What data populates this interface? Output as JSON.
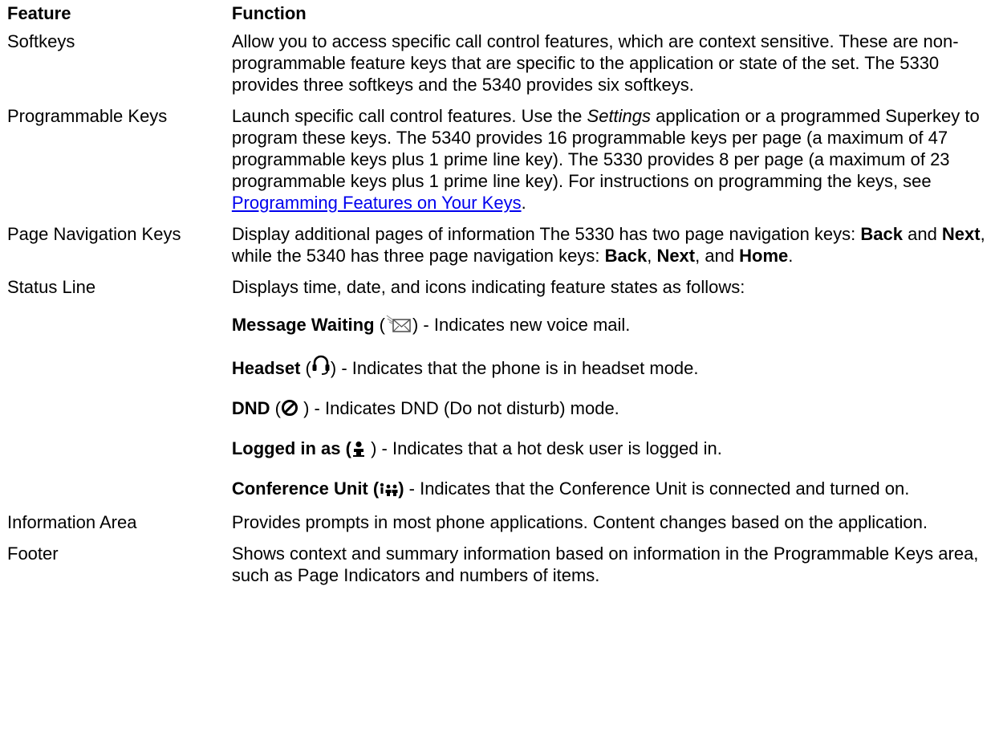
{
  "header": {
    "feature": "Feature",
    "function": "Function"
  },
  "rows": {
    "softkeys": {
      "feature": "Softkeys",
      "text": "Allow you to access specific call control features, which are context sensitive. These are non-programmable feature keys that are specific to the application or state of the set. The 5330 provides three softkeys and the 5340 provides six softkeys."
    },
    "programmable": {
      "feature": "Programmable Keys",
      "pre": "Launch specific call control features. Use the ",
      "italic": "Settings",
      "mid": " application or a programmed Superkey to program these keys. The 5340 provides 16 programmable keys per page (a maximum of 47 programmable keys plus 1 prime line key). The 5330 provides 8 per page (a maximum of 23 programmable keys plus 1 prime line key). For instructions on programming the keys, see ",
      "link": "Programming Features on Your Keys",
      "post": "."
    },
    "page_nav": {
      "feature": "Page Navigation Keys",
      "t1": "Display additional pages of information The 5330 has two page navigation keys: ",
      "b1": "Back",
      "t2": " and ",
      "b2": "Next",
      "t3": ", while the 5340 has three page navigation keys: ",
      "b3": "Back",
      "t4": ", ",
      "b4": "Next",
      "t5": ", and ",
      "b5": "Home",
      "t6": "."
    },
    "status": {
      "feature": "Status Line",
      "intro": "Displays time, date, and icons indicating feature states as follows:",
      "items": [
        {
          "label": "Message Waiting",
          "open": " (",
          "close": ")",
          "desc": " - Indicates new voice mail.",
          "icon": "message-waiting-icon"
        },
        {
          "label": "Headset",
          "open": " (",
          "close": ")",
          "desc": " - Indicates that the phone is in headset mode.",
          "icon": "headset-icon"
        },
        {
          "label": "DND",
          "open": " (",
          "close": " )",
          "desc": " - Indicates DND (Do not disturb) mode.",
          "icon": "dnd-icon"
        },
        {
          "label": "Logged in as (",
          "open": "",
          "close": " )",
          "desc": " - Indicates that a hot desk user is logged in.",
          "icon": "user-icon"
        },
        {
          "label": "Conference Unit (",
          "open": "",
          "close": ")",
          "desc": " - Indicates that the Conference Unit is connected and turned on.",
          "icon": "conference-unit-icon"
        }
      ]
    },
    "info_area": {
      "feature": "Information Area",
      "text": "Provides prompts in most phone applications. Content changes based on the application."
    },
    "footer": {
      "feature": "Footer",
      "text": "Shows context and summary information based on information in the Programmable Keys area, such as Page Indicators and numbers of items."
    }
  }
}
